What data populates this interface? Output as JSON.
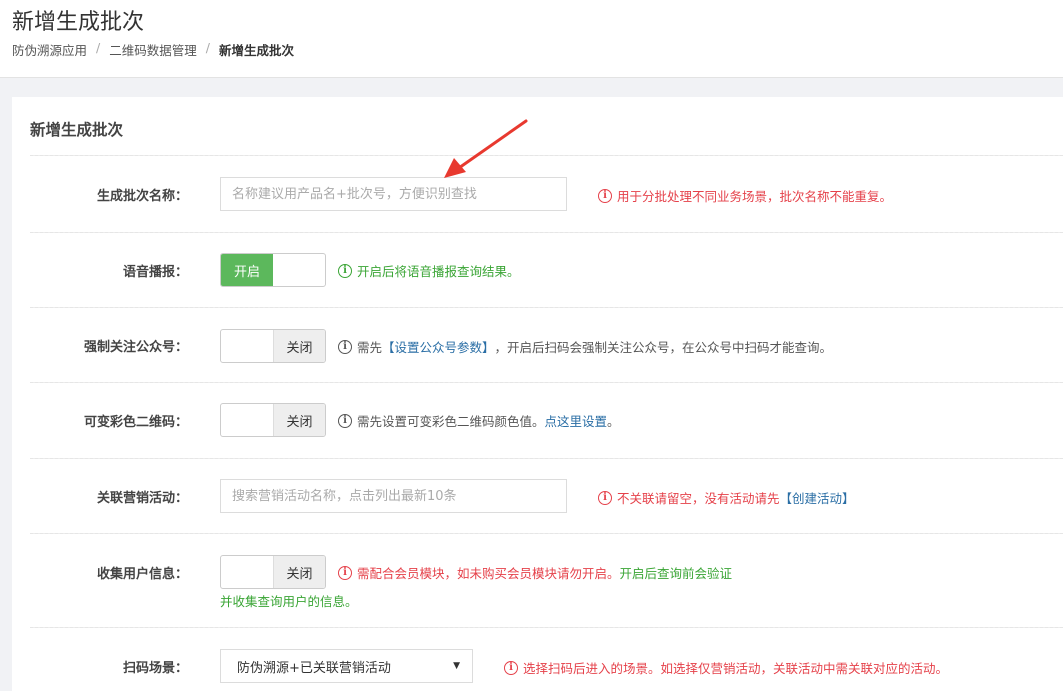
{
  "header": {
    "title": "新增生成批次",
    "breadcrumb": [
      "防伪溯源应用",
      "二维码数据管理",
      "新增生成批次"
    ]
  },
  "card": {
    "title": "新增生成批次"
  },
  "form": {
    "batch_name": {
      "label": "生成批次名称：",
      "placeholder": "名称建议用产品名+批次号，方便识别查找",
      "help": "用于分批处理不同业务场景，批次名称不能重复。"
    },
    "voice": {
      "label": "语音播报：",
      "state": "开启",
      "help": "开启后将语音播报查询结果。"
    },
    "follow": {
      "label": "强制关注公众号：",
      "state": "关闭",
      "help_prefix": "需先",
      "help_link": "【设置公众号参数】",
      "help_suffix": "，开启后扫码会强制关注公众号，在公众号中扫码才能查询。"
    },
    "color_qr": {
      "label": "可变彩色二维码：",
      "state": "关闭",
      "help_prefix": "需先设置可变彩色二维码颜色值。",
      "help_link": "点这里设置",
      "help_suffix": "。"
    },
    "campaign": {
      "label": "关联营销活动：",
      "placeholder": "搜索营销活动名称，点击列出最新10条",
      "help_prefix": "不关联请留空，没有活动请先",
      "help_link": "【创建活动】"
    },
    "collect": {
      "label": "收集用户信息：",
      "state": "关闭",
      "help_red": "需配合会员模块，如未购买会员模块请勿开启。",
      "help_green": "开启后查询前会验证",
      "help_green_line2": "并收集查询用户的信息。"
    },
    "scene": {
      "label": "扫码场景：",
      "value": "防伪溯源+已关联营销活动",
      "help": "选择扫码后进入的场景。如选择仅营销活动，关联活动中需关联对应的活动。"
    }
  },
  "colors": {
    "switch_on": "#5cb85c",
    "help_red": "#e5414a",
    "help_green": "#3aa535",
    "link": "#2a6ea5",
    "arrow": "#e8392f"
  }
}
